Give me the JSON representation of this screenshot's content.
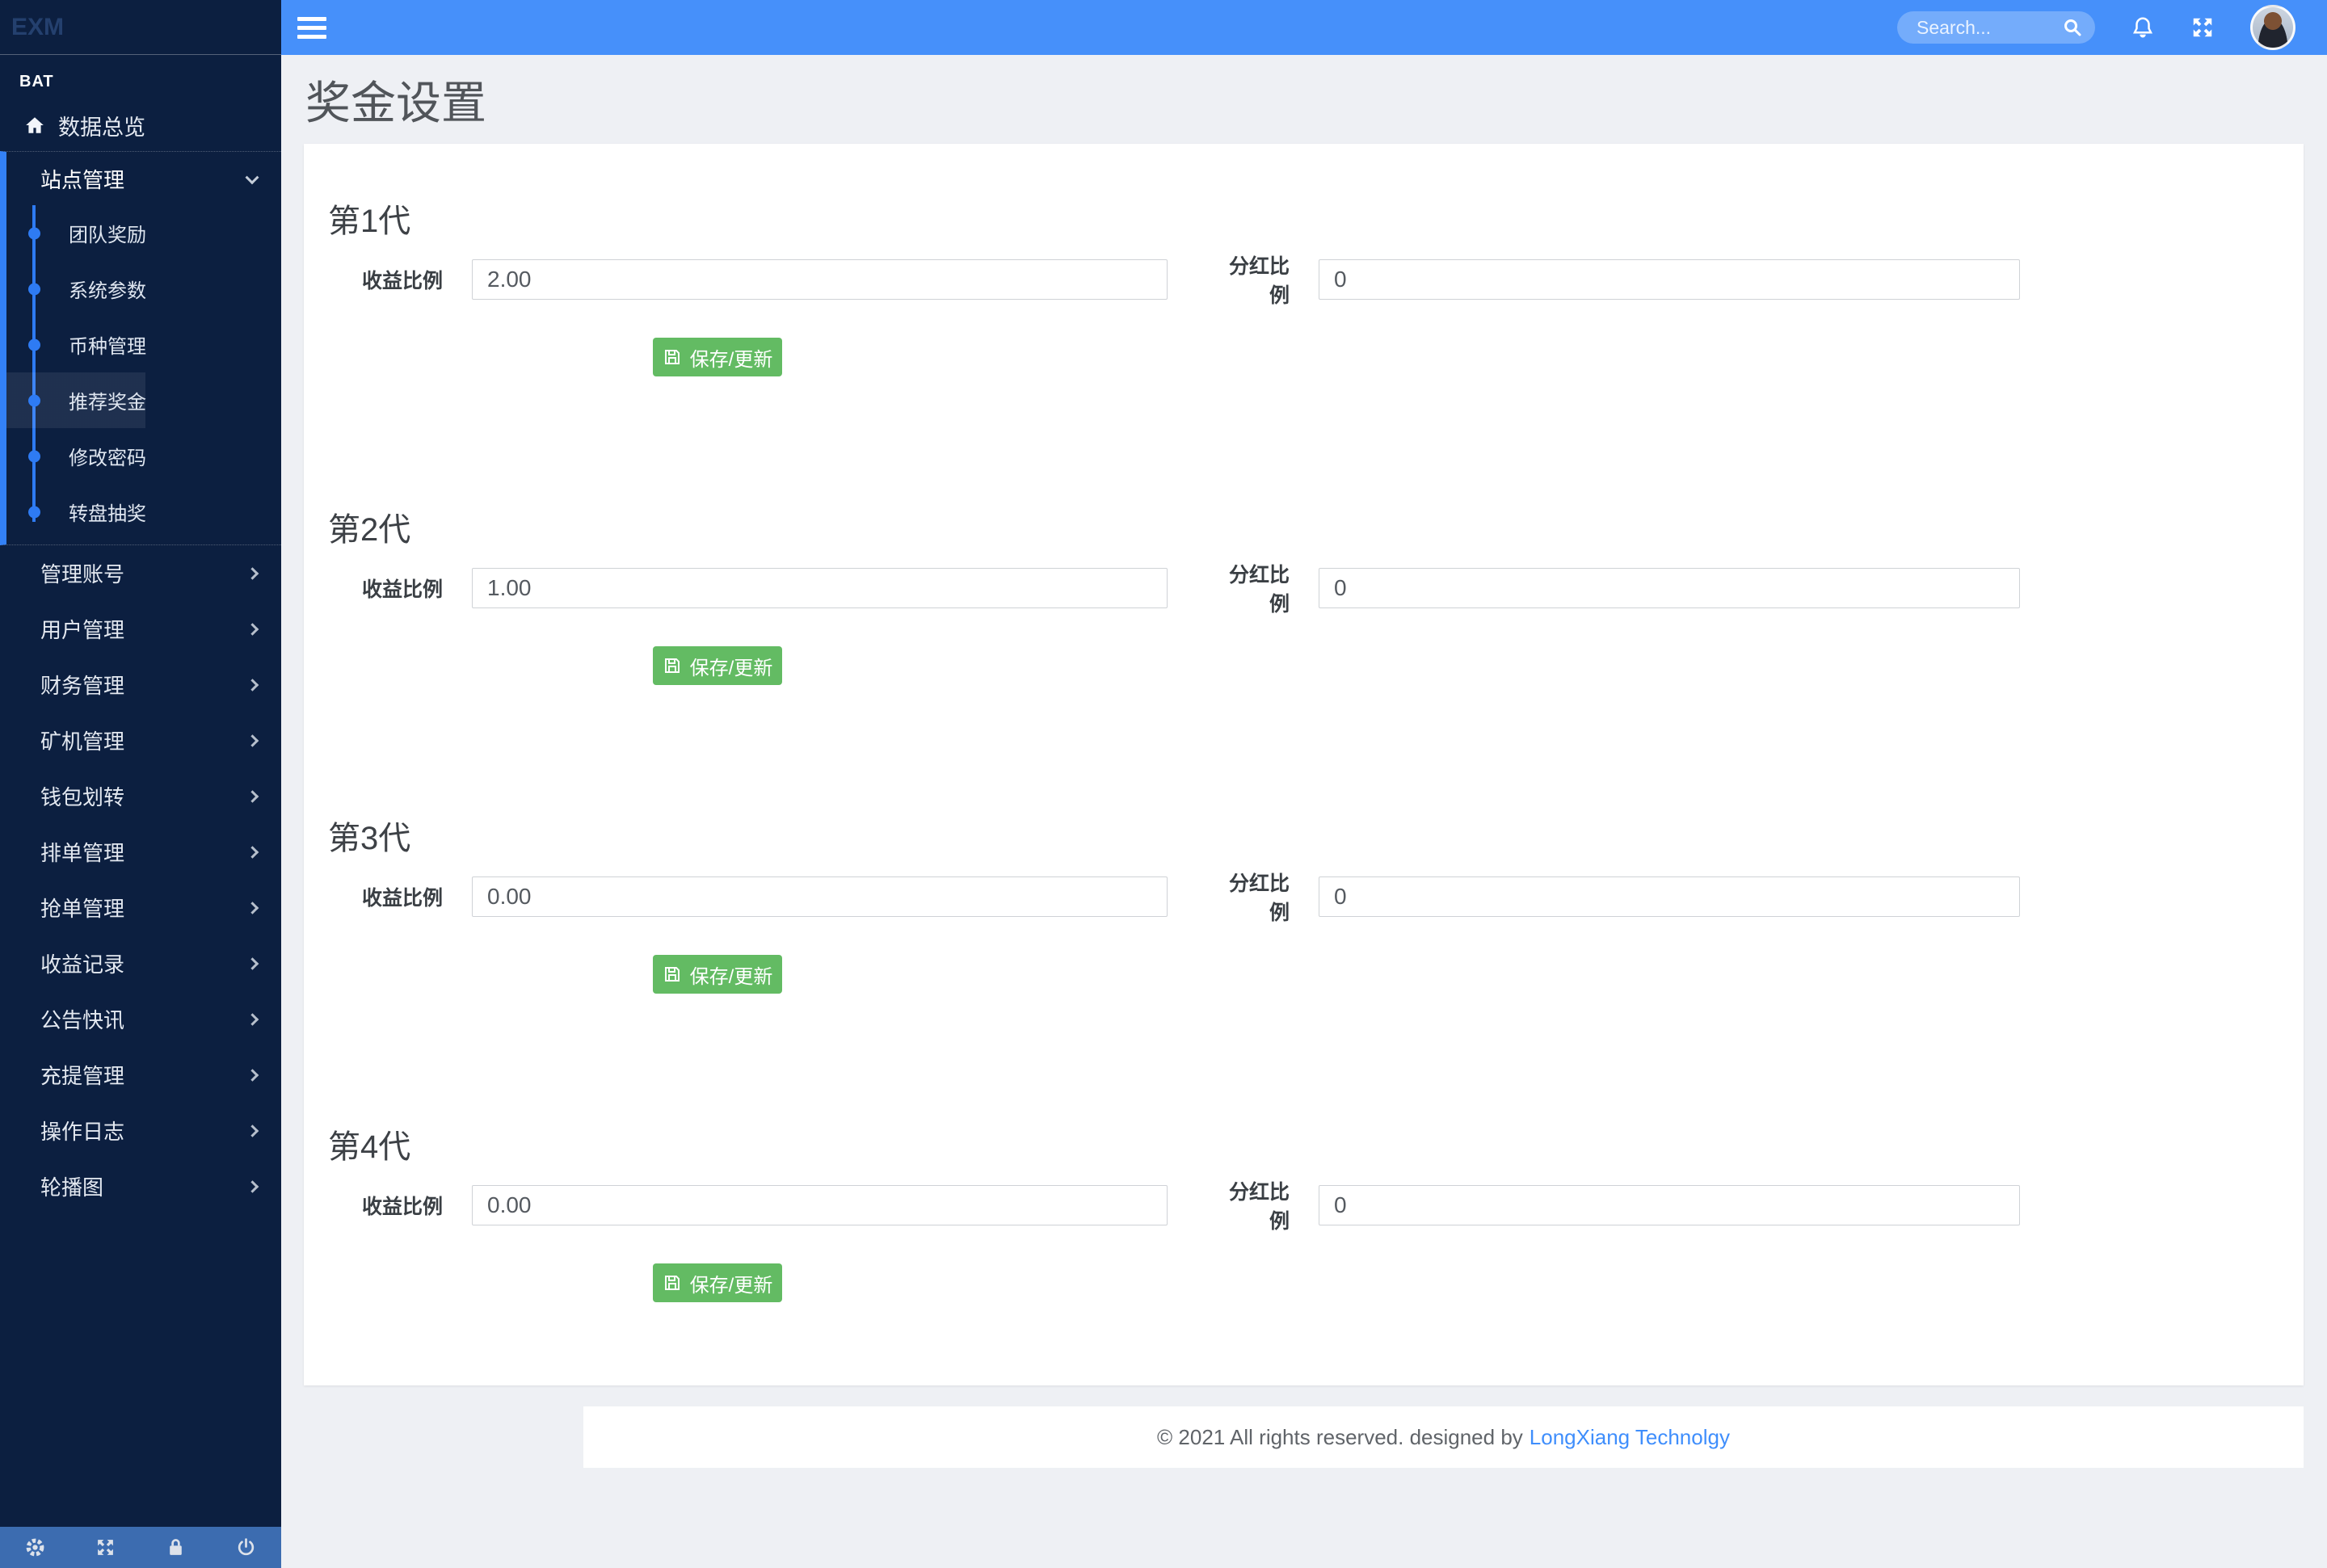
{
  "app": {
    "logo": "EXM",
    "section_label": "BAT"
  },
  "header": {
    "search_placeholder": "Search..."
  },
  "sidebar": {
    "overview_label": "数据总览",
    "group": {
      "label": "站点管理",
      "items": [
        {
          "label": "团队奖励"
        },
        {
          "label": "系统参数"
        },
        {
          "label": "币种管理"
        },
        {
          "label": "推荐奖金",
          "active": true
        },
        {
          "label": "修改密码"
        },
        {
          "label": "转盘抽奖"
        }
      ]
    },
    "items": [
      {
        "label": "管理账号"
      },
      {
        "label": "用户管理"
      },
      {
        "label": "财务管理"
      },
      {
        "label": "矿机管理"
      },
      {
        "label": "钱包划转"
      },
      {
        "label": "排单管理"
      },
      {
        "label": "抢单管理"
      },
      {
        "label": "收益记录"
      },
      {
        "label": "公告快讯"
      },
      {
        "label": "充提管理"
      },
      {
        "label": "操作日志"
      },
      {
        "label": "轮播图"
      }
    ]
  },
  "page": {
    "title": "奖金设置"
  },
  "sections": [
    {
      "heading": "第1代",
      "income_label": "收益比例",
      "income_value": "2.00",
      "dividend_label": "分红比例",
      "dividend_value": "0",
      "save_label": "保存/更新"
    },
    {
      "heading": "第2代",
      "income_label": "收益比例",
      "income_value": "1.00",
      "dividend_label": "分红比例",
      "dividend_value": "0",
      "save_label": "保存/更新"
    },
    {
      "heading": "第3代",
      "income_label": "收益比例",
      "income_value": "0.00",
      "dividend_label": "分红比例",
      "dividend_value": "0",
      "save_label": "保存/更新"
    },
    {
      "heading": "第4代",
      "income_label": "收益比例",
      "income_value": "0.00",
      "dividend_label": "分红比例",
      "dividend_value": "0",
      "save_label": "保存/更新"
    }
  ],
  "footer": {
    "text": "© 2021 All rights reserved. designed by",
    "link_text": "LongXiang Technolgy"
  },
  "colors": {
    "sidebar_bg": "#0c1f40",
    "accent_blue": "#3381f7",
    "header_blue": "#4690fa",
    "bottom_bar_blue": "#3c6cb0",
    "content_bg": "#eef0f4",
    "button_green": "#63bb63",
    "link_blue": "#3f8efc"
  }
}
